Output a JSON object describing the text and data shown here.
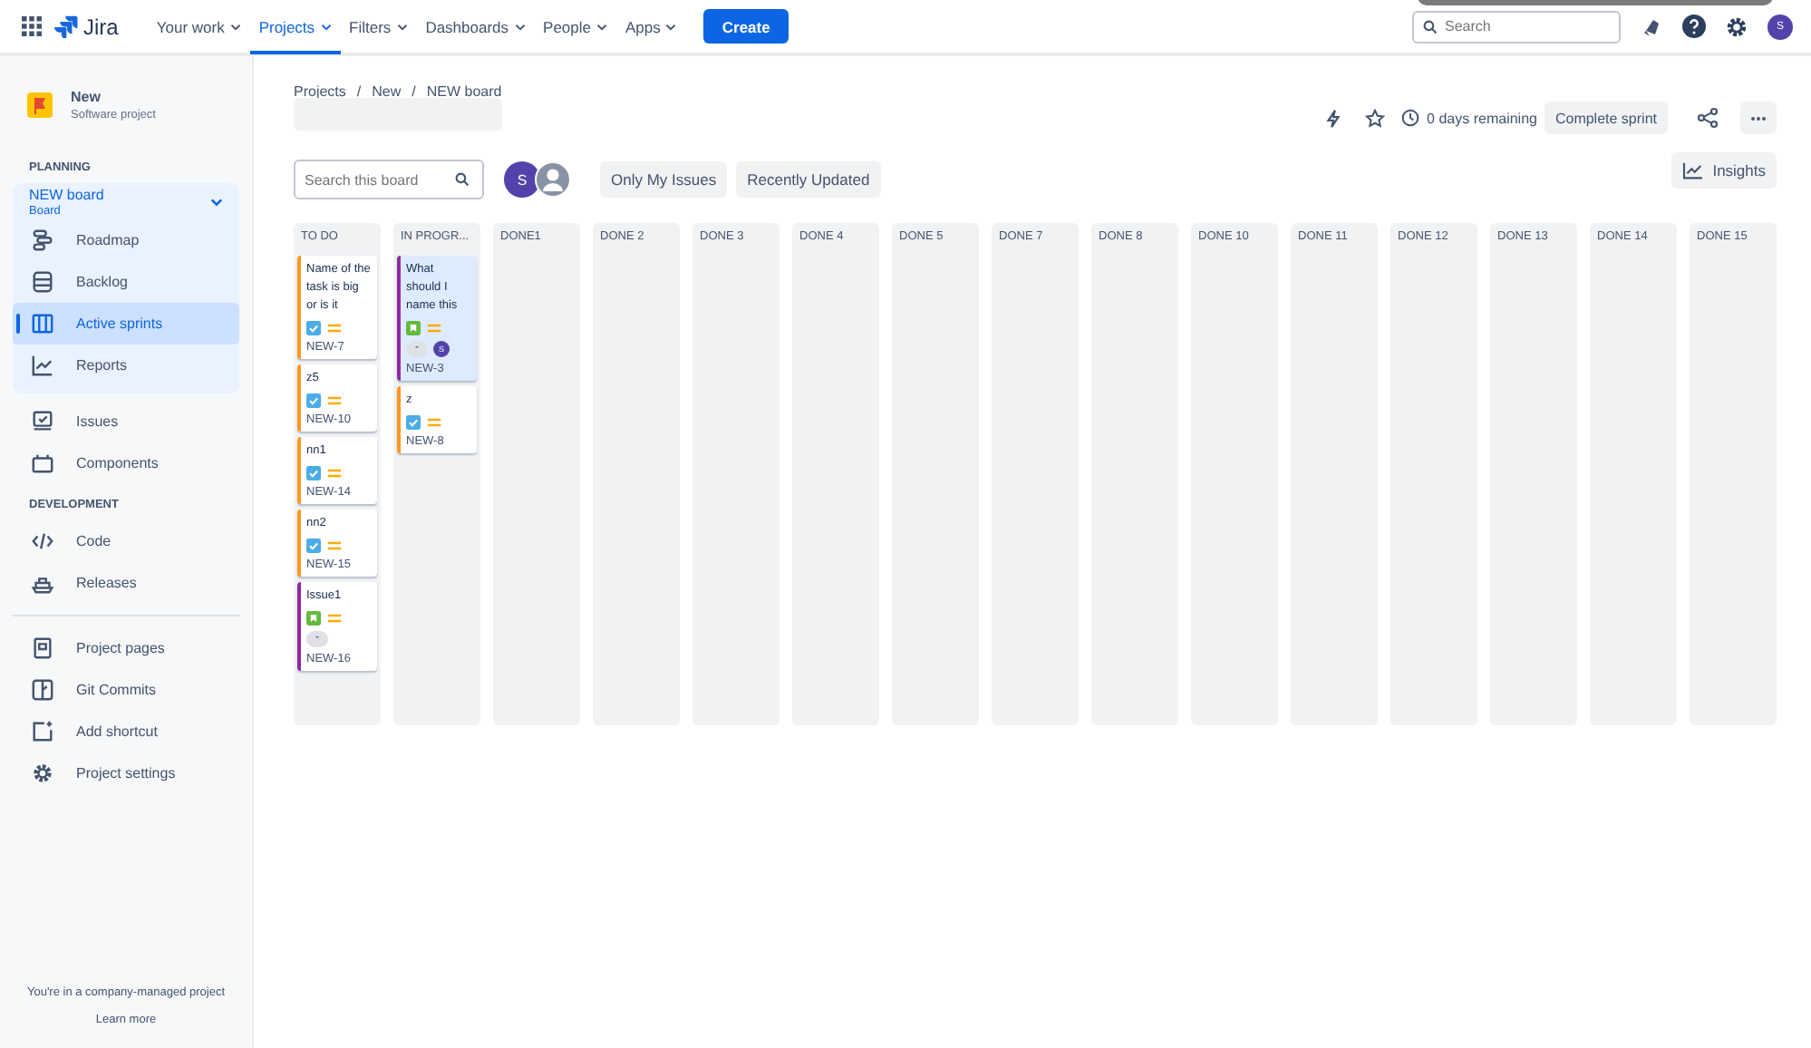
{
  "topnav": {
    "product": "Jira",
    "items": [
      {
        "label": "Your work",
        "selected": false
      },
      {
        "label": "Projects",
        "selected": true
      },
      {
        "label": "Filters",
        "selected": false
      },
      {
        "label": "Dashboards",
        "selected": false
      },
      {
        "label": "People",
        "selected": false
      },
      {
        "label": "Apps",
        "selected": false
      }
    ],
    "create": "Create",
    "search": {
      "placeholder": "Search"
    },
    "avatar": "S"
  },
  "sidebar": {
    "project": {
      "name": "New",
      "type": "Software project"
    },
    "sections": [
      {
        "heading": "PLANNING",
        "items": [
          {
            "label": "NEW board",
            "sub": "Board",
            "expanded": true,
            "children": [
              {
                "label": "Roadmap",
                "selected": false
              },
              {
                "label": "Backlog",
                "selected": false
              },
              {
                "label": "Active sprints",
                "selected": true
              },
              {
                "label": "Reports",
                "selected": false
              }
            ]
          },
          {
            "label": "Issues",
            "selected": false
          },
          {
            "label": "Components",
            "selected": false
          }
        ]
      },
      {
        "heading": "DEVELOPMENT",
        "items": [
          {
            "label": "Code",
            "selected": false
          },
          {
            "label": "Releases",
            "selected": false
          }
        ]
      },
      {
        "items": [
          {
            "label": "Project pages",
            "selected": false
          },
          {
            "label": "Git Commits",
            "selected": false
          },
          {
            "label": "Add shortcut",
            "selected": false
          },
          {
            "label": "Project settings",
            "selected": false
          }
        ]
      }
    ],
    "footer": "You're in a company-managed project",
    "learn": "Learn more"
  },
  "breadcrumbs": [
    {
      "label": "Projects"
    },
    {
      "separator": "/",
      "label": "New"
    },
    {
      "separator": "/",
      "label": "NEW board"
    }
  ],
  "sprint": {
    "remaining": "0 days remaining",
    "complete": "Complete sprint"
  },
  "filters": {
    "search": {
      "placeholder": "Search this board"
    },
    "avatar": "S",
    "buttons": [
      "Only My Issues",
      "Recently Updated"
    ],
    "insights": "Insights"
  },
  "columns": [
    {
      "title": "TO DO",
      "cards": [
        {
          "title": "Name of the task is big or is it",
          "kind": "task",
          "color": "#ff991f",
          "key": "NEW-7",
          "selected": false
        },
        {
          "title": "z5",
          "kind": "task",
          "color": "#ff991f",
          "key": "NEW-10",
          "selected": false
        },
        {
          "title": "nn1",
          "kind": "task",
          "color": "#ff991f",
          "key": "NEW-14",
          "selected": false
        },
        {
          "title": "nn2",
          "kind": "task",
          "color": "#ff991f",
          "key": "NEW-15",
          "selected": false
        },
        {
          "title": "Issue1",
          "kind": "story",
          "color": "#8f2ba1",
          "key": "NEW-16",
          "selected": false,
          "estimate": "-"
        }
      ]
    },
    {
      "title": "IN PROGR...",
      "cards": [
        {
          "title": "What should I name this",
          "kind": "story",
          "color": "#8f2ba1",
          "key": "NEW-3",
          "selected": true,
          "estimate": "-",
          "assignee": "S"
        },
        {
          "title": "z",
          "kind": "task",
          "color": "#ff991f",
          "key": "NEW-8",
          "selected": false
        }
      ]
    },
    {
      "title": "DONE1"
    },
    {
      "title": "DONE 2"
    },
    {
      "title": "DONE 3"
    },
    {
      "title": "DONE 4"
    },
    {
      "title": "DONE 5"
    },
    {
      "title": "DONE 7"
    },
    {
      "title": "DONE 8"
    },
    {
      "title": "DONE 10"
    },
    {
      "title": "DONE 11"
    },
    {
      "title": "DONE 12"
    },
    {
      "title": "DONE 13"
    },
    {
      "title": "DONE 14"
    },
    {
      "title": "DONE 15"
    }
  ]
}
